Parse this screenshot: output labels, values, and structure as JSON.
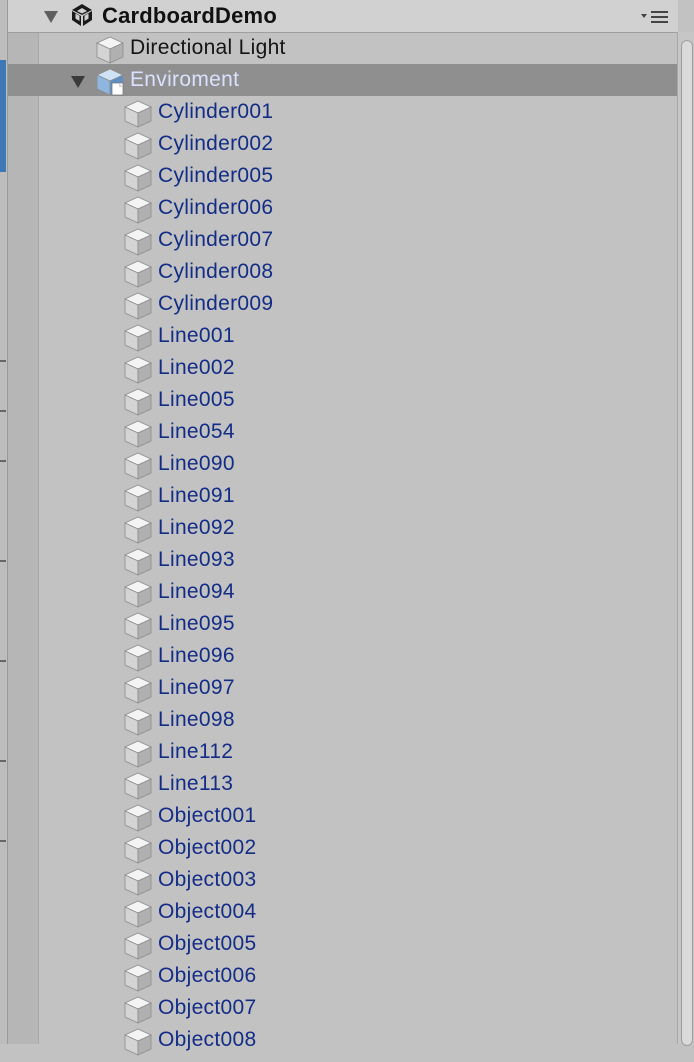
{
  "scene": {
    "name": "CardboardDemo",
    "icon": "unity-logo-icon",
    "menu_icon": "dropdown-menu-icon"
  },
  "hierarchy": {
    "root_items": [
      {
        "label": "Directional Light",
        "icon": "gameobject-cube-icon",
        "style": "plain"
      },
      {
        "label": "Enviroment",
        "icon": "prefab-cube-icon",
        "style": "selected",
        "expanded": true
      }
    ],
    "children": [
      "Cylinder001",
      "Cylinder002",
      "Cylinder005",
      "Cylinder006",
      "Cylinder007",
      "Cylinder008",
      "Cylinder009",
      "Line001",
      "Line002",
      "Line005",
      "Line054",
      "Line090",
      "Line091",
      "Line092",
      "Line093",
      "Line094",
      "Line095",
      "Line096",
      "Line097",
      "Line098",
      "Line112",
      "Line113",
      "Object001",
      "Object002",
      "Object003",
      "Object004",
      "Object005",
      "Object006",
      "Object007",
      "Object008"
    ]
  },
  "colors": {
    "panel_bg": "#c2c2c2",
    "prefab_text": "#132d86",
    "selected_bg": "#8f8f8f",
    "selected_text": "#d9e1ff"
  }
}
